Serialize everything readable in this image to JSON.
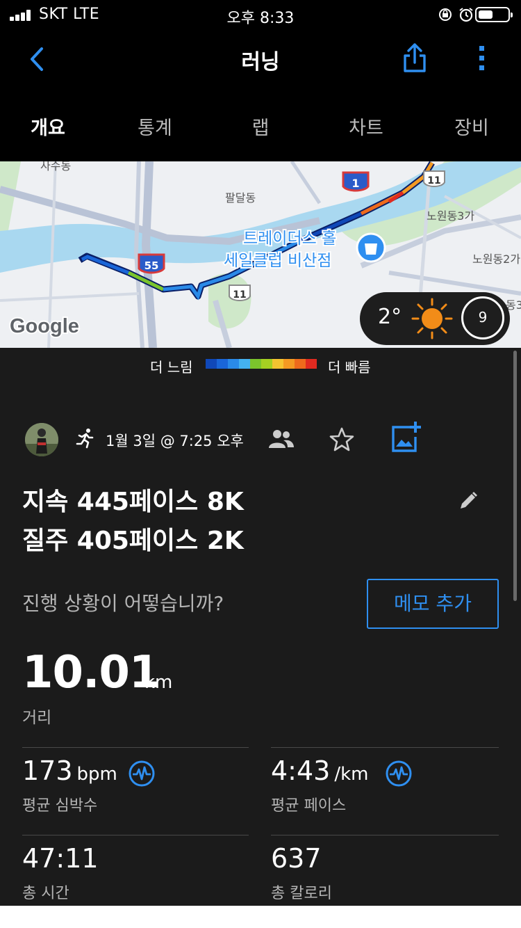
{
  "status_bar": {
    "carrier": "SKT   LTE",
    "time": "오후 8:33"
  },
  "header": {
    "title": "러닝"
  },
  "tabs": [
    {
      "label": "개요",
      "active": true
    },
    {
      "label": "통계",
      "active": false
    },
    {
      "label": "랩",
      "active": false
    },
    {
      "label": "차트",
      "active": false
    },
    {
      "label": "장비",
      "active": false
    }
  ],
  "map": {
    "provider_logo": "Google",
    "labels": {
      "district_1": "사수동",
      "district_2": "팔달동",
      "district_3": "노원동3가",
      "district_4": "노원동2가",
      "district_5": "동3",
      "poi_line1": "트레이더스 홀",
      "poi_line2": "세일클럽 비산점"
    },
    "shields": {
      "route_1": "1",
      "route_55": "55",
      "route_11_a": "11",
      "route_11_b": "11"
    },
    "weather": {
      "temperature": "2°",
      "wind": "9",
      "icon": "sun-icon"
    }
  },
  "legend": {
    "slow_label": "더 느림",
    "fast_label": "더 빠름",
    "colors": [
      "#1048b8",
      "#1a66d8",
      "#2a8ae8",
      "#44b2f0",
      "#7bc42c",
      "#a6d022",
      "#f4c430",
      "#f49a22",
      "#ee6a1c",
      "#e02a20"
    ]
  },
  "activity": {
    "type_icon": "running-icon",
    "date": "1월 3일 @ 7:25 오후",
    "title_line1": "지속 445페이스 8K",
    "title_line2": "질주 405페이스 2K",
    "prompt": "진행 상황이 어떻습니까?",
    "memo_button": "메모 추가"
  },
  "stats": {
    "distance": {
      "value": "10.01",
      "unit": "km",
      "label": "거리"
    },
    "heart_rate": {
      "value": "173",
      "unit": "bpm",
      "label": "평균 심박수"
    },
    "pace": {
      "value": "4:43",
      "unit": "/km",
      "label": "평균 페이스"
    },
    "time": {
      "value": "47:11",
      "label": "총 시간"
    },
    "calories": {
      "value": "637",
      "label": "총 칼로리"
    }
  },
  "colors": {
    "accent": "#2f8ff0",
    "background": "#1b1b1b",
    "header_bg": "#000000",
    "secondary_text": "#b5b5b5"
  }
}
